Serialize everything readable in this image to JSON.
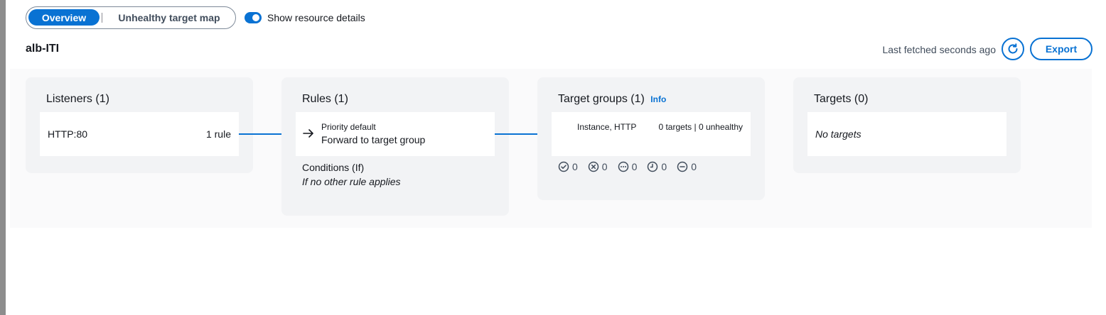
{
  "segments": {
    "overview": "Overview",
    "unhealthy": "Unhealthy target map"
  },
  "toggle": {
    "label": "Show resource details",
    "checked": true
  },
  "load_balancer": {
    "name": "alb-ITI"
  },
  "header": {
    "last_fetched": "Last fetched seconds ago",
    "export_label": "Export"
  },
  "listeners": {
    "title": "Listeners (1)",
    "items": [
      {
        "protocol_port": "HTTP:80",
        "rules": "1 rule"
      }
    ]
  },
  "rules": {
    "title": "Rules (1)",
    "items": [
      {
        "priority": "Priority default",
        "action": "Forward to target group"
      }
    ],
    "conditions_label": "Conditions (If)",
    "conditions_value": "If no other rule applies"
  },
  "target_groups": {
    "title": "Target groups (1)",
    "info_label": "Info",
    "items": [
      {
        "type": "Instance, HTTP",
        "summary": "0 targets | 0 unhealthy"
      }
    ],
    "status_counts": {
      "healthy": "0",
      "unhealthy": "0",
      "unused": "0",
      "initial": "0",
      "draining": "0"
    }
  },
  "targets": {
    "title": "Targets (0)",
    "empty": "No targets"
  },
  "colors": {
    "accent": "#0972d3",
    "card_bg": "#f2f3f5"
  }
}
